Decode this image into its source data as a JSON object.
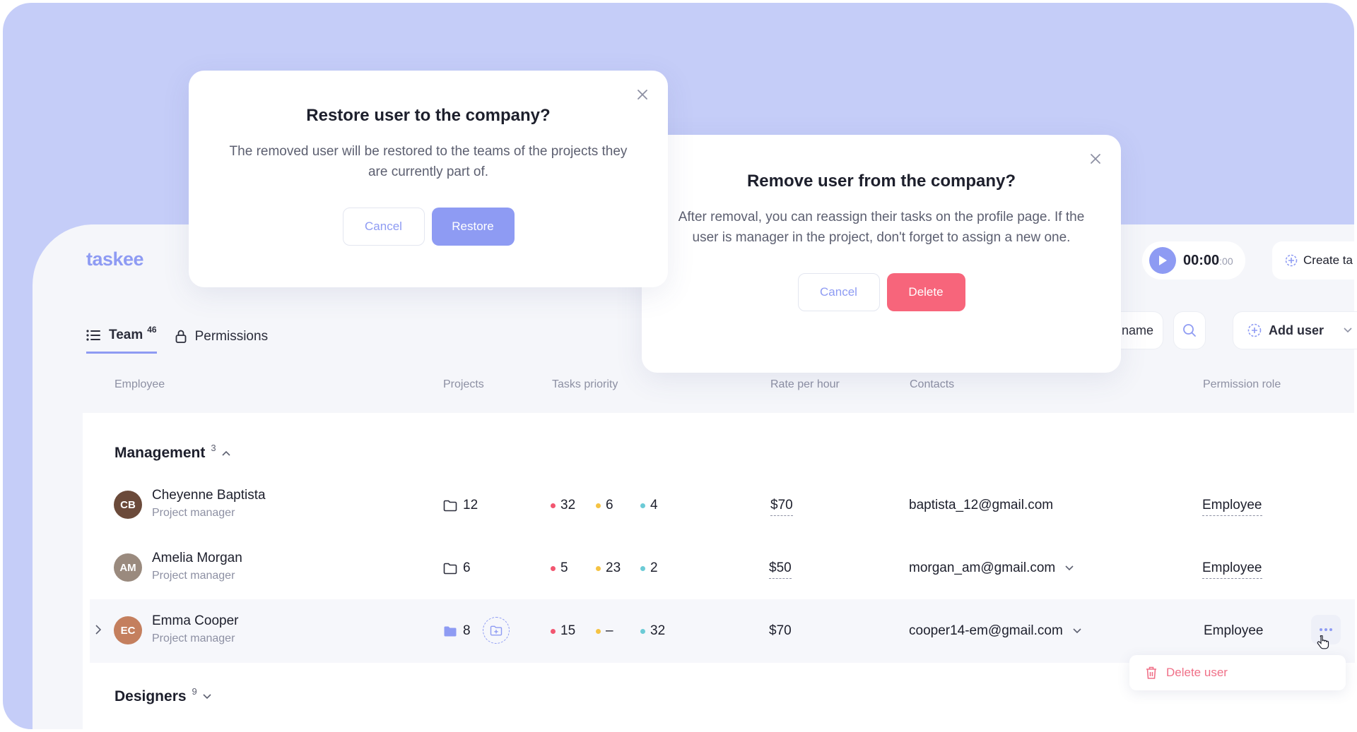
{
  "app": {
    "logo": "taskee"
  },
  "header": {
    "timer": {
      "main": "00:00",
      "small": ":00"
    },
    "create_task_label": "Create ta"
  },
  "tabs": [
    {
      "label": "Team",
      "count": "46"
    },
    {
      "label": "Permissions"
    }
  ],
  "toolbar": {
    "name_sort_label": "name",
    "add_user_label": "Add user"
  },
  "columns": {
    "employee": "Employee",
    "projects": "Projects",
    "tasks_priority": "Tasks priority",
    "rate": "Rate per hour",
    "contacts": "Contacts",
    "permission_role": "Permission role"
  },
  "groups": [
    {
      "title": "Management",
      "count": "3"
    },
    {
      "title": "Designers",
      "count": "9"
    }
  ],
  "rows": [
    {
      "initials": "CB",
      "name": "Cheyenne Baptista",
      "role": "Project manager",
      "projects": "12",
      "prio_high": "32",
      "prio_med": "6",
      "prio_low": "4",
      "rate": "$70",
      "email": "baptista_12@gmail.com",
      "permission": "Employee",
      "avatar_color": "#6b4a3a"
    },
    {
      "initials": "AM",
      "name": "Amelia Morgan",
      "role": "Project manager",
      "projects": "6",
      "prio_high": "5",
      "prio_med": "23",
      "prio_low": "2",
      "rate": "$50",
      "email": "morgan_am@gmail.com",
      "permission": "Employee",
      "avatar_color": "#9a8a7e"
    },
    {
      "initials": "EC",
      "name": "Emma Cooper",
      "role": "Project manager",
      "projects": "8",
      "prio_high": "15",
      "prio_med": "–",
      "prio_low": "32",
      "rate": "$70",
      "email": "cooper14-em@gmail.com",
      "permission": "Employee",
      "avatar_color": "#c47f5e"
    }
  ],
  "context_menu": {
    "delete_user_label": "Delete user"
  },
  "modal_restore": {
    "title": "Restore user to the company?",
    "body": "The removed user will be restored to the teams of the projects they are currently part of.",
    "cancel_label": "Cancel",
    "confirm_label": "Restore"
  },
  "modal_remove": {
    "title": "Remove user from the company?",
    "body": "After removal, you can reassign their tasks on the profile page. If the user is manager in the project, don't forget to assign a new one.",
    "cancel_label": "Cancel",
    "confirm_label": "Delete"
  },
  "colors": {
    "accent": "#8e9bf3",
    "danger": "#f7657b",
    "background": "#c5cdf8",
    "prio_high": "#f25670",
    "prio_med": "#f5c343",
    "prio_low": "#6ccbd6"
  }
}
